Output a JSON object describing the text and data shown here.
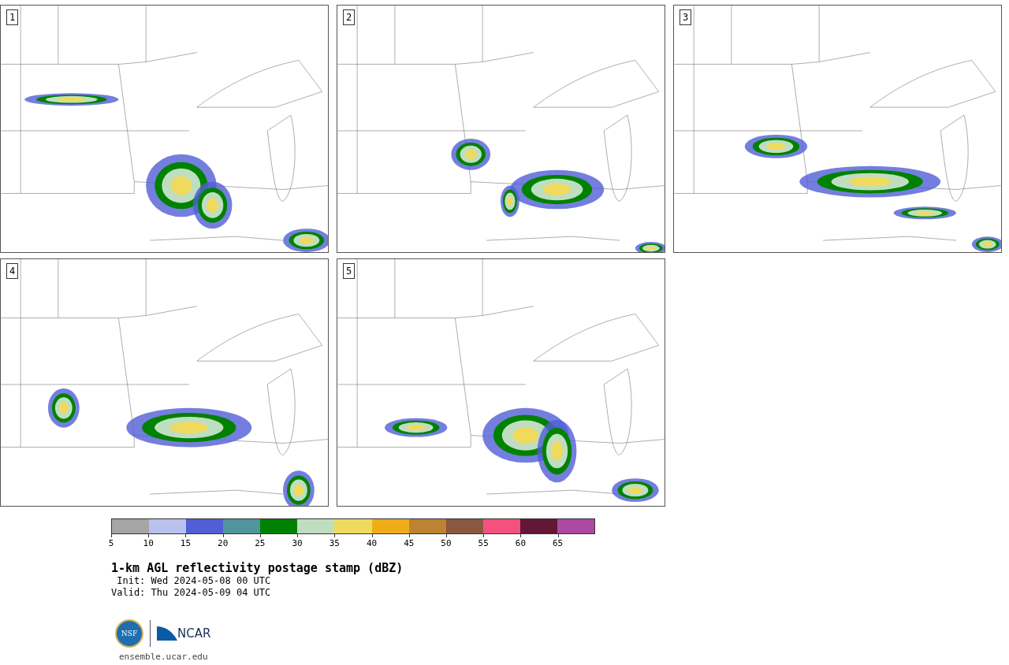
{
  "panels": [
    {
      "label": "1"
    },
    {
      "label": "2"
    },
    {
      "label": "3"
    },
    {
      "label": "4"
    },
    {
      "label": "5"
    }
  ],
  "colorbar": {
    "segments": [
      {
        "color": "#a5a5a5",
        "tick": "5"
      },
      {
        "color": "#b8c2ed",
        "tick": "10"
      },
      {
        "color": "#515ed6",
        "tick": "15"
      },
      {
        "color": "#51959c",
        "tick": "20"
      },
      {
        "color": "#008200",
        "tick": "25"
      },
      {
        "color": "#bfdec0",
        "tick": "30"
      },
      {
        "color": "#f0da5e",
        "tick": "35"
      },
      {
        "color": "#efae18",
        "tick": "40"
      },
      {
        "color": "#bb8332",
        "tick": "45"
      },
      {
        "color": "#8a583f",
        "tick": "50"
      },
      {
        "color": "#f5517e",
        "tick": "55"
      },
      {
        "color": "#621735",
        "tick": "60"
      },
      {
        "color": "#ab4aa2",
        "tick": "65"
      }
    ]
  },
  "title": "1-km AGL reflectivity postage stamp (dBZ)",
  "init": " Init: Wed 2024-05-08 00 UTC",
  "valid": "Valid: Thu 2024-05-09 04 UTC",
  "logo": {
    "nsf": "NSF",
    "ncar": "NCAR"
  },
  "footer": "ensemble.ucar.edu"
}
